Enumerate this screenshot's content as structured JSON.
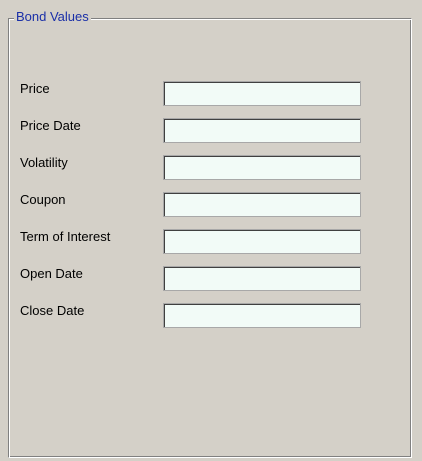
{
  "groupbox": {
    "title": "Bond Values"
  },
  "fields": [
    {
      "label": "Price",
      "value": ""
    },
    {
      "label": "Price Date",
      "value": ""
    },
    {
      "label": "Volatility",
      "value": ""
    },
    {
      "label": "Coupon",
      "value": ""
    },
    {
      "label": "Term of Interest",
      "value": ""
    },
    {
      "label": "Open Date",
      "value": ""
    },
    {
      "label": "Close Date",
      "value": ""
    }
  ],
  "colors": {
    "background": "#d4d0c8",
    "group_title": "#1a2fa8",
    "input_background": "#f2fbf7"
  }
}
